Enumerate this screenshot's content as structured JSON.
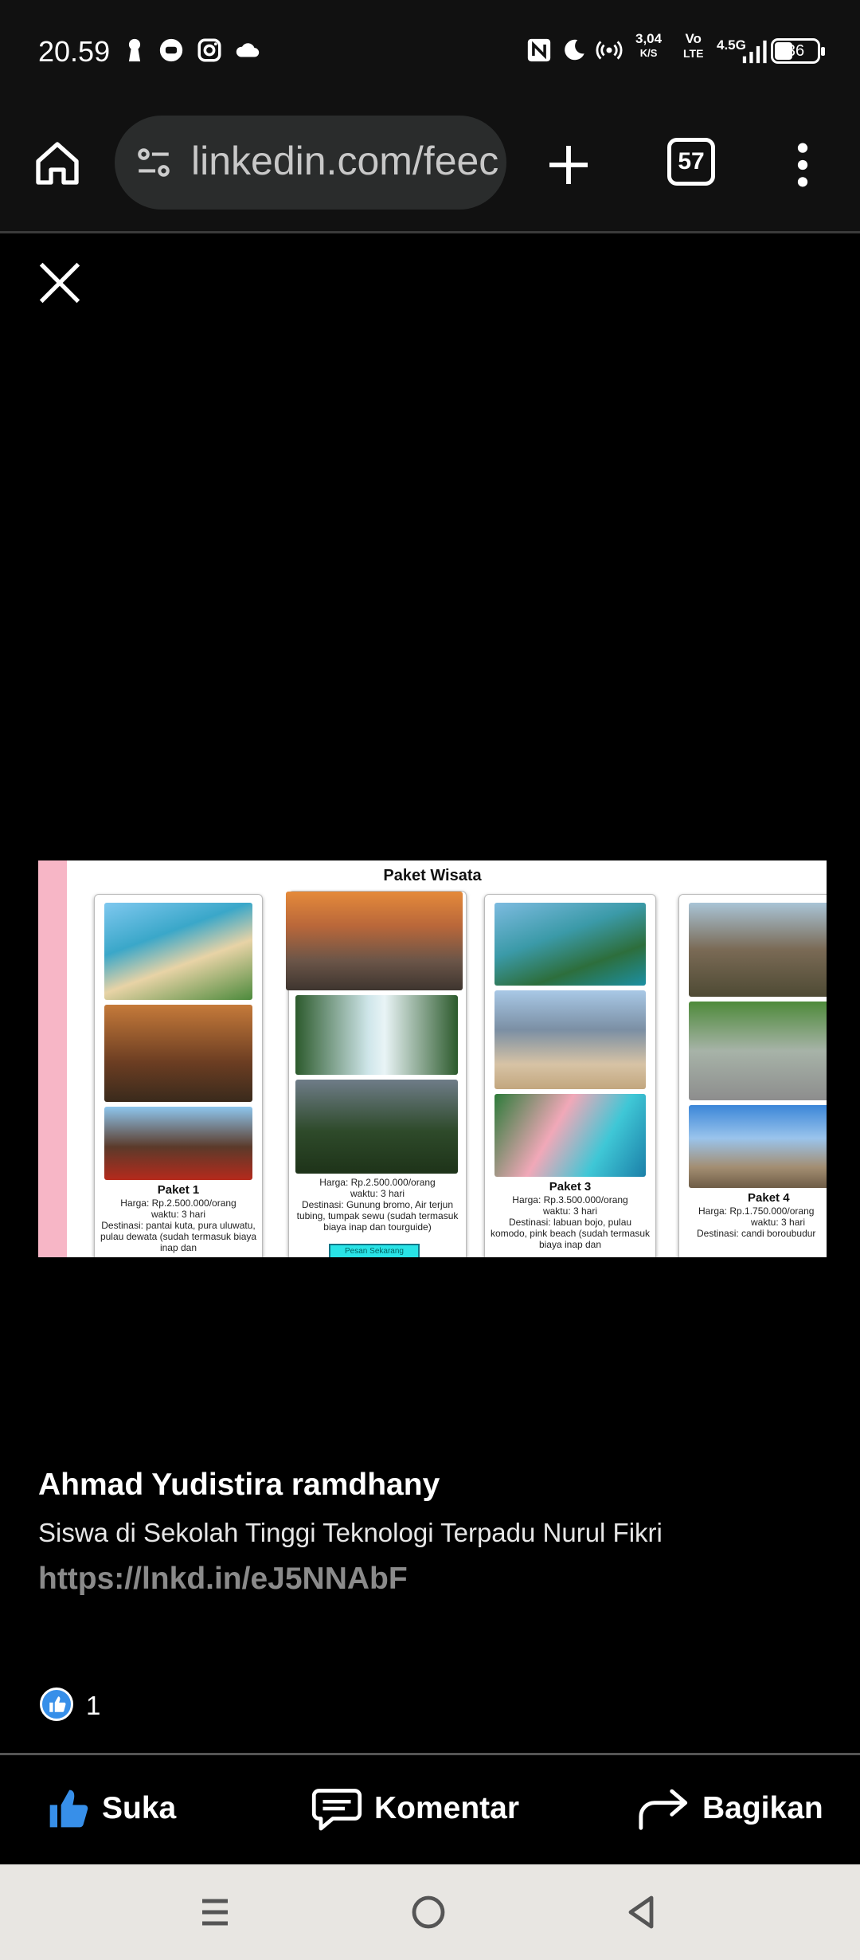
{
  "status_bar": {
    "time": "20.59",
    "speed_value": "3,04",
    "speed_unit": "K/S",
    "volte_top": "Vo",
    "volte_bottom": "LTE",
    "network": "4.5G",
    "battery": "36",
    "left_icons": [
      "keyhole-icon",
      "chat-bubble-icon",
      "instagram-icon",
      "cloud-icon"
    ],
    "right_icons": [
      "nfc-icon",
      "moon-icon",
      "hotspot-icon",
      "signal-icon",
      "battery-icon"
    ]
  },
  "browser": {
    "url": "linkedin.com/feec",
    "tab_count": "57"
  },
  "post_image": {
    "title": "Paket Wisata",
    "packages": [
      {
        "title": "Paket 1",
        "price": "Harga: Rp.2.500.000/orang",
        "duration": "waktu: 3 hari",
        "destinations": "Destinasi: pantai kuta, pura uluwatu, pulau dewata (sudah termasuk biaya inap dan"
      },
      {
        "title": "",
        "price": "Harga: Rp.2.500.000/orang",
        "duration": "waktu: 3 hari",
        "destinations": "Destinasi: Gunung bromo, Air terjun tubing, tumpak sewu (sudah termasuk biaya inap dan tourguide)",
        "button": "Pesan Sekarang"
      },
      {
        "title": "Paket 3",
        "price": "Harga: Rp.3.500.000/orang",
        "duration": "waktu: 3 hari",
        "destinations": "Destinasi: labuan bojo, pulau komodo, pink beach (sudah termasuk biaya inap dan"
      },
      {
        "title": "Paket 4",
        "price": "Harga: Rp.1.750.000/orang",
        "duration": "waktu: 3 hari",
        "destinations": "Destinasi: candi boroubudur"
      }
    ]
  },
  "post": {
    "author_name": "Ahmad Yudistira ramdhany",
    "author_headline": "Siswa di Sekolah Tinggi Teknologi Terpadu Nurul Fikri",
    "link": "https://lnkd.in/eJ5NNAbF",
    "reaction_count": "1"
  },
  "actions": {
    "like": "Suka",
    "comment": "Komentar",
    "share": "Bagikan"
  },
  "colors": {
    "like_blue": "#378fe9",
    "background": "#000000"
  }
}
